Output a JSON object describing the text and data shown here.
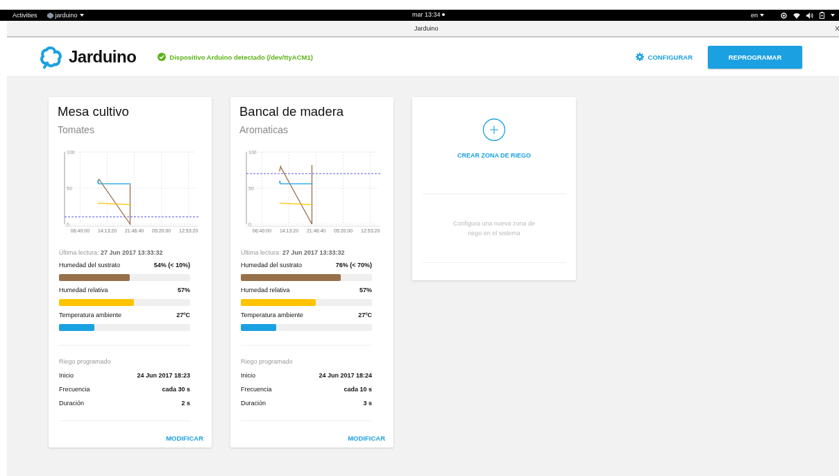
{
  "system_bar": {
    "activities": "Activities",
    "app_menu": "jarduino",
    "clock": "mar 13:34",
    "language": "en"
  },
  "window": {
    "title": "Jarduino"
  },
  "header": {
    "logo": "Jarduino",
    "status": {
      "text": "Dispositivo Arduino detectado (/dev/ttyACM1)",
      "connected": true
    },
    "configure": "CONFIGURAR",
    "reprogram": "REPROGRAMAR"
  },
  "zones": [
    {
      "title": "Mesa cultivo",
      "subtitle": "Tomates",
      "chart_data": {
        "type": "line",
        "grid": true,
        "xlim": [
          "2017-06-26T02:19:20",
          "2017-06-27T14:53:20"
        ],
        "ylim": [
          0,
          100
        ],
        "yticks": [
          0,
          50,
          100
        ],
        "xticks": [
          {
            "value": "2017-06-26T06:40:00",
            "label": "06:40:00"
          },
          {
            "value": "2017-06-26T14:13:20",
            "label": "14:13:20"
          },
          {
            "value": "2017-06-26T21:46:40",
            "label": "21:46:40"
          },
          {
            "value": "2017-06-27T05:20:00",
            "label": "05:20:00"
          },
          {
            "value": "2017-06-27T12:53:20",
            "label": "12:53:20"
          }
        ],
        "series": [
          {
            "color": "#98704a",
            "x": [
              "2017-06-26T11:40:00",
              "2017-06-26T11:56:40",
              "2017-06-26T20:36:40",
              "2017-06-26T20:36:40"
            ],
            "values": [
              60,
              62,
              0,
              55
            ]
          },
          {
            "color": "#ffc300",
            "x": [
              "2017-06-26T11:33:20",
              "2017-06-26T20:48:20"
            ],
            "values": [
              29,
              27
            ]
          },
          {
            "color": "#1ba1e2",
            "x": [
              "2017-06-26T11:33:20",
              "2017-06-26T11:40:00",
              "2017-06-26T11:48:20",
              "2017-06-26T20:48:20"
            ],
            "values": [
              57,
              61,
              56,
              56
            ]
          }
        ],
        "ref_lines": [
          {
            "axis": "y",
            "value": 10,
            "color": "#5b5bf0"
          }
        ]
      },
      "last_reading": "Última lectura: **27 Jun 2017 13:33:32**",
      "sensors": [
        {
          "label": "Humedad del sustrato",
          "reading": "54% (< 10%)",
          "level": 0.54,
          "color": "#98704a"
        },
        {
          "label": "Humedad relativa",
          "reading": "57%",
          "level": 0.57,
          "color": "#ffc300"
        },
        {
          "label": "Temperatura ambiente",
          "reading": "27ºC",
          "level": 0.27,
          "color": "#1ba1e2"
        }
      ],
      "schedule_title": "Riego programado",
      "schedule": [
        {
          "label": "Inicio",
          "value": "24 Jun 2017 18:23"
        },
        {
          "label": "Frecuencia",
          "value": "cada 30 s"
        },
        {
          "label": "Duración",
          "value": "2 s"
        }
      ],
      "action": "MODIFICAR"
    },
    {
      "title": "Bancal de madera",
      "subtitle": "Aromaticas",
      "chart_data": {
        "type": "line",
        "grid": true,
        "xlim": [
          "2017-06-26T02:19:20",
          "2017-06-27T14:53:20"
        ],
        "ylim": [
          0,
          100
        ],
        "yticks": [
          0,
          50,
          100
        ],
        "xticks": [
          {
            "value": "2017-06-26T06:40:00",
            "label": "06:40:00"
          },
          {
            "value": "2017-06-26T14:13:20",
            "label": "14:13:20"
          },
          {
            "value": "2017-06-26T21:46:40",
            "label": "21:46:40"
          },
          {
            "value": "2017-06-27T05:20:00",
            "label": "05:20:00"
          },
          {
            "value": "2017-06-27T12:53:20",
            "label": "12:53:20"
          }
        ],
        "series": [
          {
            "color": "#98704a",
            "x": [
              "2017-06-26T11:33:20",
              "2017-06-26T11:53:20",
              "2017-06-26T12:08:20",
              "2017-06-26T20:36:40",
              "2017-06-26T20:36:40"
            ],
            "values": [
              73,
              80,
              77,
              0,
              82
            ]
          },
          {
            "color": "#ffc300",
            "x": [
              "2017-06-26T11:33:20",
              "2017-06-26T20:48:20"
            ],
            "values": [
              29,
              27
            ]
          },
          {
            "color": "#1ba1e2",
            "x": [
              "2017-06-26T11:33:20",
              "2017-06-26T11:40:00",
              "2017-06-26T11:48:20",
              "2017-06-26T20:48:20"
            ],
            "values": [
              57,
              60,
              56,
              56
            ]
          }
        ],
        "ref_lines": [
          {
            "axis": "y",
            "value": 70,
            "color": "#5b5bf0"
          }
        ]
      },
      "last_reading": "Última lectura: **27 Jun 2017 13:33:32**",
      "sensors": [
        {
          "label": "Humedad del sustrato",
          "reading": "76% (< 70%)",
          "level": 0.76,
          "color": "#98704a"
        },
        {
          "label": "Humedad relativa",
          "reading": "57%",
          "level": 0.57,
          "color": "#ffc300"
        },
        {
          "label": "Temperatura ambiente",
          "reading": "27ºC",
          "level": 0.27,
          "color": "#1ba1e2"
        }
      ],
      "schedule_title": "Riego programado",
      "schedule": [
        {
          "label": "Inicio",
          "value": "24 Jun 2017 18:24"
        },
        {
          "label": "Frecuencia",
          "value": "cada 10 s"
        },
        {
          "label": "Duración",
          "value": "3 s"
        }
      ],
      "action": "MODIFICAR"
    }
  ],
  "new_zone": {
    "action": "CREAR ZONA DE RIEGO",
    "description": "Configura una nueva zona de riego en el sistema"
  }
}
